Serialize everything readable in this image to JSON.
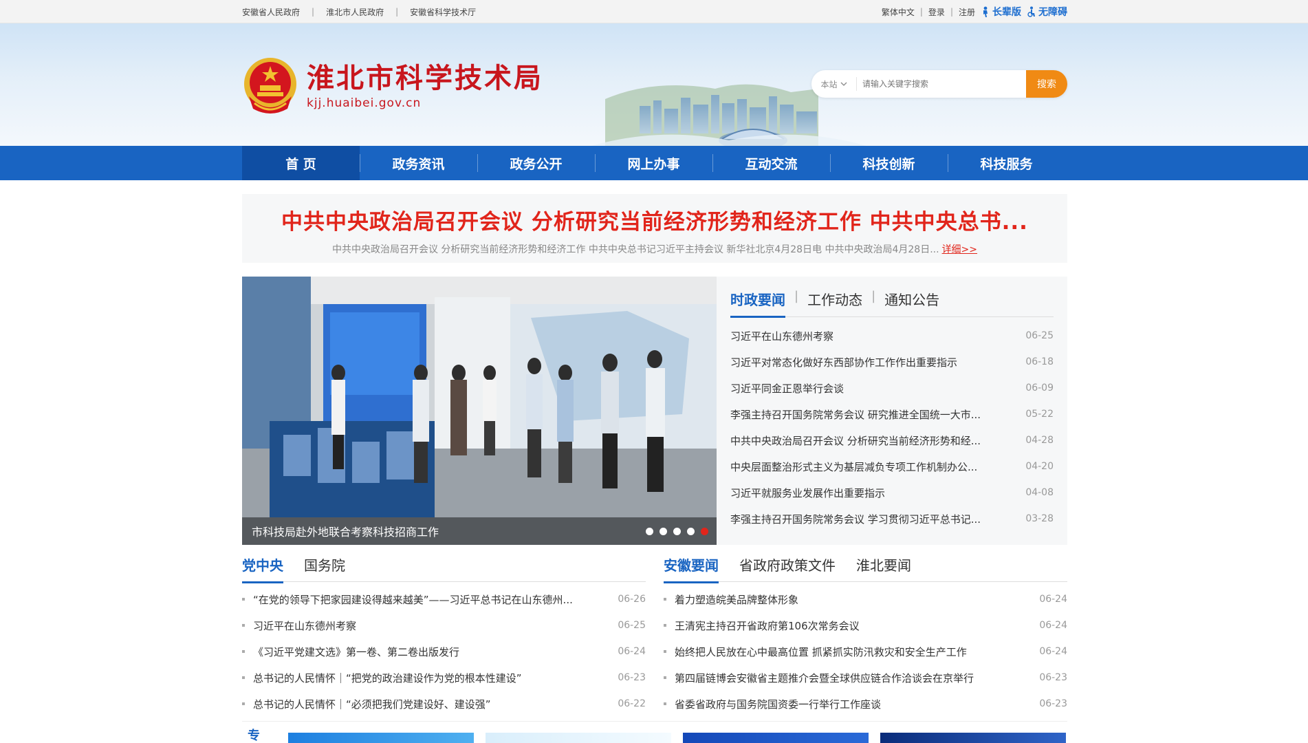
{
  "topbar": {
    "links": [
      "安徽省人民政府",
      "淮北市人民政府",
      "安徽省科学技术厅"
    ],
    "right": {
      "traditional": "繁体中文",
      "login": "登录",
      "register": "注册",
      "elder": "长辈版",
      "accessible": "无障碍"
    }
  },
  "header": {
    "title": "淮北市科学技术局",
    "domain": "kjj.huaibei.gov.cn",
    "search": {
      "scope": "本站",
      "placeholder": "请输入关键字搜索",
      "button": "搜索"
    }
  },
  "nav": [
    "首 页",
    "政务资讯",
    "政务公开",
    "网上办事",
    "互动交流",
    "科技创新",
    "科技服务"
  ],
  "headline": {
    "title": "中共中央政治局召开会议 分析研究当前经济形势和经济工作 中共中央总书...",
    "summary": "中共中央政治局召开会议 分析研究当前经济形势和经济工作 中共中央总书记习近平主持会议 新华社北京4月28日电 中共中央政治局4月28日...",
    "more": "详细>>"
  },
  "slider": {
    "caption": "市科技局赴外地联合考察科技招商工作",
    "dots": 5,
    "active": 5
  },
  "newsbox": {
    "tabs": [
      "时政要闻",
      "工作动态",
      "通知公告"
    ],
    "items": [
      {
        "t": "习近平在山东德州考察",
        "d": "06-25"
      },
      {
        "t": "习近平对常态化做好东西部协作工作作出重要指示",
        "d": "06-18"
      },
      {
        "t": "习近平同金正恩举行会谈",
        "d": "06-09"
      },
      {
        "t": "李强主持召开国务院常务会议 研究推进全国统一大市...",
        "d": "05-22"
      },
      {
        "t": "中共中央政治局召开会议 分析研究当前经济形势和经...",
        "d": "04-28"
      },
      {
        "t": "中央层面整治形式主义为基层减负专项工作机制办公...",
        "d": "04-20"
      },
      {
        "t": "习近平就服务业发展作出重要指示",
        "d": "04-08"
      },
      {
        "t": "李强主持召开国务院常务会议 学习贯彻习近平总书记...",
        "d": "03-28"
      }
    ]
  },
  "left_col": {
    "tabs": [
      "党中央",
      "国务院"
    ],
    "items": [
      {
        "t": "“在党的领导下把家园建设得越来越美”——习近平总书记在山东德州...",
        "d": "06-26"
      },
      {
        "t": "习近平在山东德州考察",
        "d": "06-25"
      },
      {
        "t": "《习近平党建文选》第一卷、第二卷出版发行",
        "d": "06-24"
      },
      {
        "t": "总书记的人民情怀｜“把党的政治建设作为党的根本性建设”",
        "d": "06-23"
      },
      {
        "t": "总书记的人民情怀｜“必须把我们党建设好、建设强”",
        "d": "06-22"
      }
    ]
  },
  "right_col": {
    "tabs": [
      "安徽要闻",
      "省政府政策文件",
      "淮北要闻"
    ],
    "items": [
      {
        "t": "着力塑造皖美品牌整体形象",
        "d": "06-24"
      },
      {
        "t": "王清宪主持召开省政府第106次常务会议",
        "d": "06-24"
      },
      {
        "t": "始终把人民放在心中最高位置 抓紧抓实防汛救灾和安全生产工作",
        "d": "06-24"
      },
      {
        "t": "第四届链博会安徽省主题推介会暨全球供应链合作洽谈会在京举行",
        "d": "06-23"
      },
      {
        "t": "省委省政府与国务院国资委一行举行工作座谈",
        "d": "06-23"
      }
    ]
  },
  "strip_mark": "专"
}
